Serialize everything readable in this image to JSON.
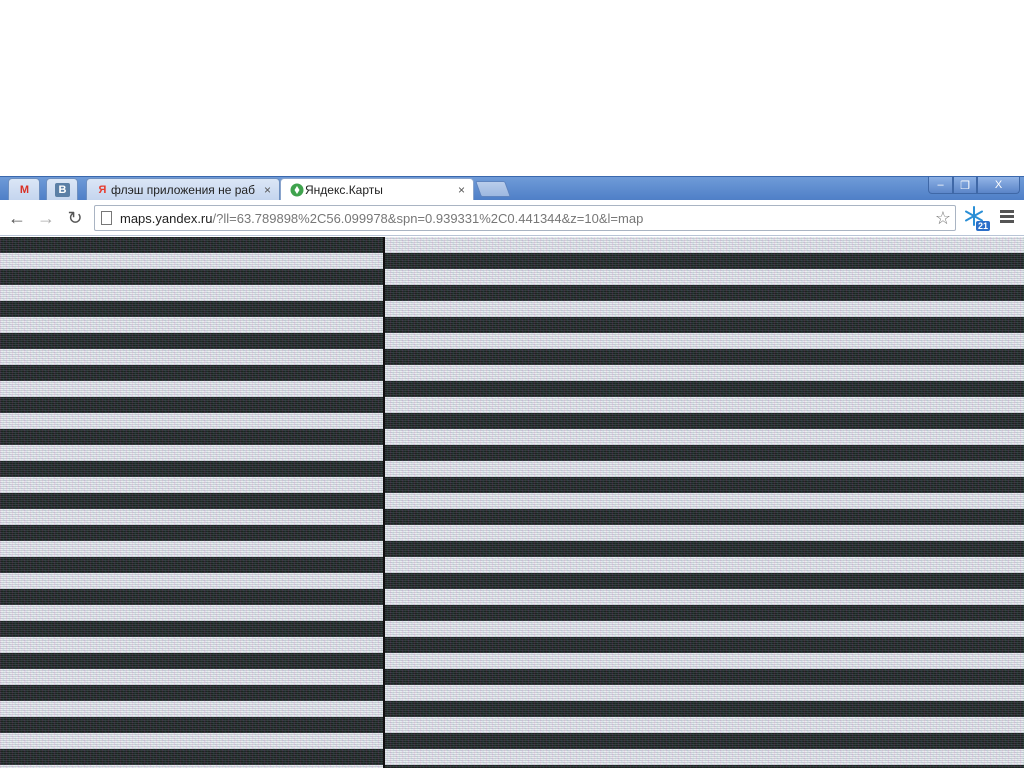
{
  "tabs": [
    {
      "kind": "pinned",
      "favicon": "gmail-icon",
      "label": "M",
      "color": "#d93025"
    },
    {
      "kind": "pinned",
      "favicon": "vk-icon",
      "label": "В",
      "color": "#5b7fa6"
    },
    {
      "kind": "normal",
      "favicon": "yandex-icon",
      "icon_text": "Я",
      "title": "флэш приложения не работ",
      "close": "×",
      "color": "#e63b2e"
    },
    {
      "kind": "active",
      "favicon": "yandex-maps-icon",
      "icon_text": "",
      "title": "Яндекс.Карты",
      "close": "×",
      "color": "#3fa34d"
    }
  ],
  "window_controls": {
    "minimize": "–",
    "maximize": "❐",
    "close": "X"
  },
  "toolbar": {
    "back": "←",
    "forward": "→",
    "reload": "↻",
    "url_host": "maps.yandex.ru",
    "url_rest": "/?ll=63.789898%2C56.099978&spn=0.939331%2C0.441344&z=10&l=map",
    "star": "☆",
    "extension_badge": "21"
  },
  "content": {
    "state": "corrupted-render"
  }
}
